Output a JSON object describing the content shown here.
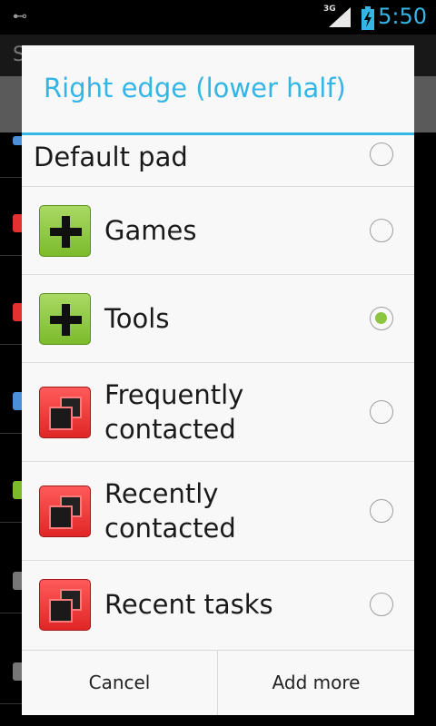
{
  "status_bar": {
    "network": "3G",
    "time": "5:50"
  },
  "background": {
    "header_peek": "S",
    "dot_colors": [
      "#4a90d9",
      "#e53030",
      "#e53030",
      "#4a90d9",
      "#7cbb2c",
      "#777777",
      "#777777"
    ]
  },
  "dialog": {
    "title": "Right edge (lower half)",
    "items": [
      {
        "label": "Default pad",
        "icon": "none",
        "selected": false
      },
      {
        "label": "Games",
        "icon": "green-plus-icon",
        "selected": false
      },
      {
        "label": "Tools",
        "icon": "green-plus-icon",
        "selected": true
      },
      {
        "label": "Frequently contacted",
        "icon": "red-windows-icon",
        "selected": false
      },
      {
        "label": "Recently contacted",
        "icon": "red-windows-icon",
        "selected": false
      },
      {
        "label": "Recent tasks",
        "icon": "red-windows-icon",
        "selected": false
      }
    ],
    "buttons": {
      "cancel": "Cancel",
      "add_more": "Add more"
    }
  }
}
